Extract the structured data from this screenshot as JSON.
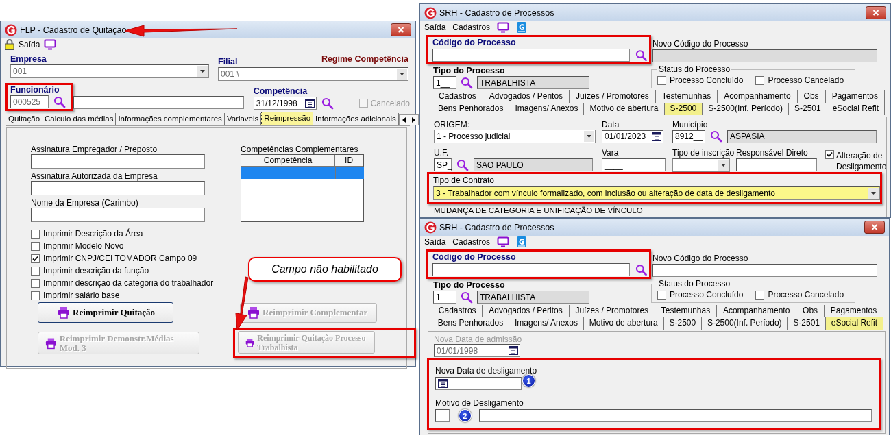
{
  "quitacao": {
    "title": "FLP - Cadastro de Quitação",
    "menu": [
      "Saída"
    ],
    "empresa": {
      "label": "Empresa",
      "value": "001"
    },
    "filial": {
      "label": "Filial",
      "value": "001 \\"
    },
    "regime": "Regime Competência",
    "funcionario": {
      "label": "Funcionário",
      "code": "000525",
      "highlighted": true
    },
    "competencia": {
      "label": "Competência",
      "value": "31/12/1998"
    },
    "cancelado": {
      "label": "Cancelado",
      "checked": false,
      "disabled": true
    },
    "tabs": [
      {
        "label": "Quitação",
        "selected": false
      },
      {
        "label": "Calculo das médias",
        "selected": false
      },
      {
        "label": "Informações complementares",
        "selected": false
      },
      {
        "label": "Variaveis",
        "selected": false
      },
      {
        "label": "Reimpressão",
        "selected": true
      },
      {
        "label": "Informações adicionais",
        "selected": false
      }
    ],
    "signature_fields": [
      "Assinatura Empregador / Preposto",
      "Assinatura Autorizada da Empresa",
      "Nome da Empresa (Carimbo)"
    ],
    "complementares": {
      "title": "Competências Complementares",
      "columns": [
        "Competência",
        "ID"
      ]
    },
    "options": [
      {
        "label": "Imprimir Descrição da Área",
        "checked": false
      },
      {
        "label": "Imprimir Modelo Novo",
        "checked": false
      },
      {
        "label": "Imprimir CNPJ/CEI TOMADOR Campo 09",
        "checked": true
      },
      {
        "label": "Imprimir descrição da função",
        "checked": false
      },
      {
        "label": "Imprimir descrição da categoria do trabalhador",
        "checked": false
      },
      {
        "label": "Imprimir salário base",
        "checked": false
      }
    ],
    "buttons": [
      {
        "label": "Reimprimir Quitação",
        "disabled": false,
        "highlighted": false
      },
      {
        "label": "Reimprimir Complementar",
        "disabled": true,
        "highlighted": false
      },
      {
        "label": "Reimprimir Demonstr.Médias Mod. 3",
        "disabled": true,
        "highlighted": false
      },
      {
        "label": "Reimprimir Quitação Processo Trabalhista",
        "disabled": true,
        "highlighted": true
      }
    ],
    "callout": "Campo não habilitado"
  },
  "processos": [
    {
      "title": "SRH - Cadastro de Processos",
      "menu": [
        "Saída",
        "Cadastros"
      ],
      "codigo": {
        "label": "Código do Processo",
        "highlighted": true
      },
      "novo_codigo": {
        "label": "Novo Código do Processo",
        "disabled": true
      },
      "tipo": {
        "label": "Tipo do Processo",
        "code": "1__",
        "name": "TRABALHISTA"
      },
      "status": {
        "legend": "Status do Processo",
        "options": [
          {
            "label": "Processo Concluído",
            "checked": false
          },
          {
            "label": "Processo Cancelado",
            "checked": false
          }
        ]
      },
      "tab_rows": [
        [
          {
            "label": "Cadastros",
            "selected": false
          },
          {
            "label": "Advogados / Peritos",
            "selected": false
          },
          {
            "label": "Juízes / Promotores",
            "selected": false
          },
          {
            "label": "Testemunhas",
            "selected": false
          },
          {
            "label": "Acompanhamento",
            "selected": false
          },
          {
            "label": "Obs",
            "selected": false
          },
          {
            "label": "Pagamentos",
            "selected": false
          }
        ],
        [
          {
            "label": "Bens Penhorados",
            "selected": false
          },
          {
            "label": "Imagens/ Anexos",
            "selected": false
          },
          {
            "label": "Motivo de abertura",
            "selected": false
          },
          {
            "label": "S-2500",
            "selected": true
          },
          {
            "label": "S-2500(Inf. Período)",
            "selected": false
          },
          {
            "label": "S-2501",
            "selected": false
          },
          {
            "label": "eSocial Refit",
            "selected": false
          }
        ]
      ],
      "panel": {
        "kind": "s2500",
        "origem": {
          "label": "ORIGEM:",
          "value": "1 - Processo judicial"
        },
        "data": {
          "label": "Data",
          "value": "01/01/2023"
        },
        "municipio": {
          "label": "Município",
          "code": "8912__",
          "name": "ASPASIA"
        },
        "uf": {
          "label": "U.F.",
          "code": "SP_",
          "name": "SAO PAULO"
        },
        "vara": {
          "label": "Vara",
          "value": "____"
        },
        "tipo_inscricao": {
          "label": "Tipo de inscrição"
        },
        "responsavel": {
          "label": "Responsável Direto"
        },
        "alteracao": {
          "label": "Alteração de Desligamento",
          "checked": true
        },
        "contrato": {
          "label": "Tipo de Contrato",
          "value": "3 - Trabalhador com vínculo formalizado, com inclusão ou alteração de data de desligamento",
          "highlighted": true
        },
        "section": "MUDANÇA DE CATEGORIA E UNIFICAÇÃO DE VÍNCULO"
      }
    },
    {
      "title": "SRH - Cadastro de Processos",
      "menu": [
        "Saída",
        "Cadastros"
      ],
      "codigo": {
        "label": "Código do Processo",
        "highlighted": true
      },
      "novo_codigo": {
        "label": "Novo Código do Processo",
        "disabled": false
      },
      "tipo": {
        "label": "Tipo do Processo",
        "code": "1__",
        "name": "TRABALHISTA"
      },
      "status": {
        "legend": "Status do Processo",
        "options": [
          {
            "label": "Processo Concluído",
            "checked": false
          },
          {
            "label": "Processo Cancelado",
            "checked": false
          }
        ]
      },
      "tab_rows": [
        [
          {
            "label": "Cadastros",
            "selected": false
          },
          {
            "label": "Advogados / Peritos",
            "selected": false
          },
          {
            "label": "Juízes / Promotores",
            "selected": false
          },
          {
            "label": "Testemunhas",
            "selected": false
          },
          {
            "label": "Acompanhamento",
            "selected": false
          },
          {
            "label": "Obs",
            "selected": false
          },
          {
            "label": "Pagamentos",
            "selected": false
          }
        ],
        [
          {
            "label": "Bens Penhorados",
            "selected": false
          },
          {
            "label": "Imagens/ Anexos",
            "selected": false
          },
          {
            "label": "Motivo de abertura",
            "selected": false
          },
          {
            "label": "S-2500",
            "selected": false
          },
          {
            "label": "S-2500(Inf. Período)",
            "selected": false
          },
          {
            "label": "S-2501",
            "selected": false
          },
          {
            "label": "eSocial Refit",
            "selected": true
          }
        ]
      ],
      "panel": {
        "kind": "refit",
        "admissao": {
          "label": "Nova Data de admissão",
          "value": "01/01/1998",
          "disabled": true
        },
        "desligamento": {
          "label": "Nova Data de desligamento",
          "badge": "1"
        },
        "motivo": {
          "label": "Motivo de Desligamento",
          "badge": "2"
        },
        "highlighted": true
      }
    }
  ]
}
